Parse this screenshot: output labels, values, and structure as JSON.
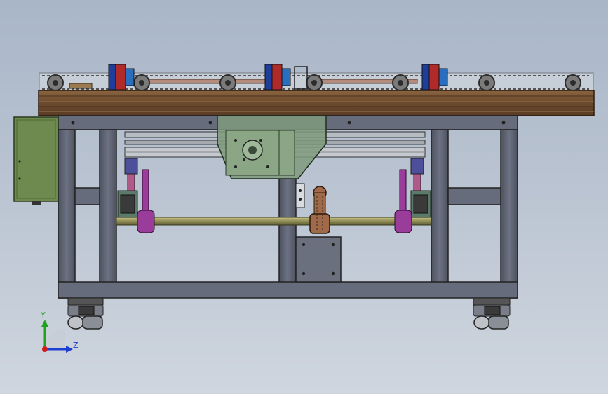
{
  "viewport": {
    "background_top": "#a9b6c8",
    "background_bottom": "#cfd6df"
  },
  "colors": {
    "frame": "#5b6170",
    "frame_dark": "#3a3f4a",
    "wood": "#6b4a2e",
    "wood_light": "#8a6440",
    "gearbox": "#7f9a7c",
    "control_box": "#6f8a4e",
    "shaft": "#8f8c55",
    "bearing_purple": "#9a3c9a",
    "chain_link": "#6a5a4a",
    "axis_y": "#1fa31f",
    "axis_z": "#1d3fd1",
    "axis_origin": "#d01e1e"
  },
  "triad": {
    "y_label": "Y",
    "z_label": "Z"
  }
}
